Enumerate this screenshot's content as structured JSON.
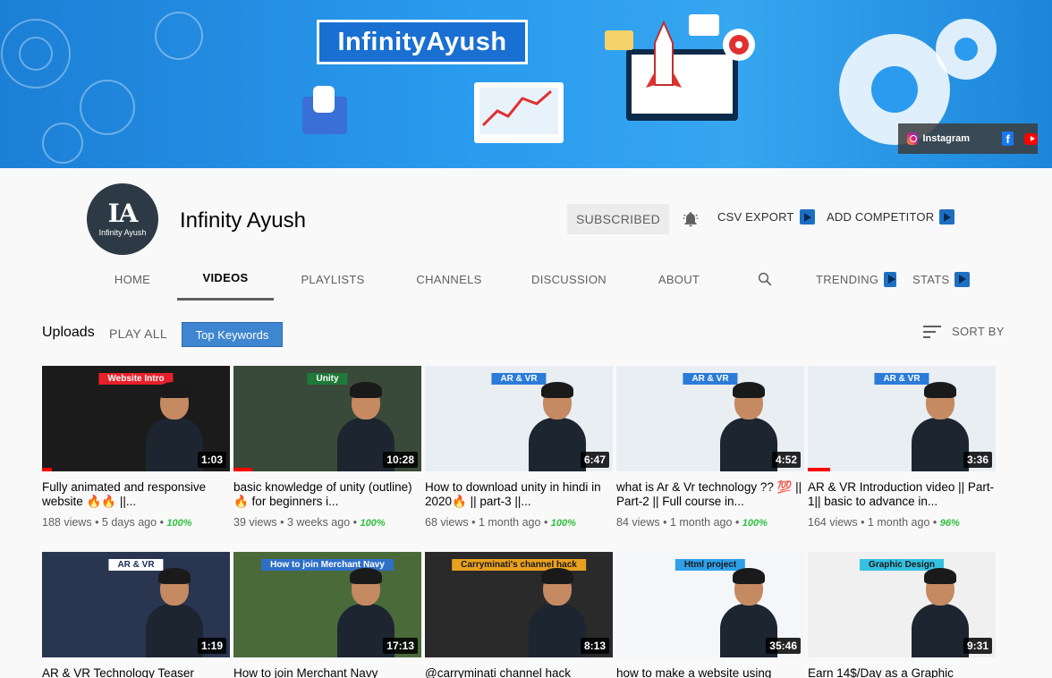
{
  "banner": {
    "title": "InfinityAyush",
    "social_label": "Instagram"
  },
  "channel": {
    "avatar_text": "IA",
    "avatar_sub": "Infinity Ayush",
    "name": "Infinity Ayush",
    "subscribed_label": "SUBSCRIBED",
    "csv_export_label": "CSV EXPORT",
    "add_competitor_label": "ADD COMPETITOR"
  },
  "tabs": {
    "home": "HOME",
    "videos": "VIDEOS",
    "playlists": "PLAYLISTS",
    "channels": "CHANNELS",
    "discussion": "DISCUSSION",
    "about": "ABOUT",
    "trending": "TRENDING",
    "stats": "STATS"
  },
  "uploads": {
    "title": "Uploads",
    "play_all": "PLAY ALL",
    "top_keywords": "Top Keywords",
    "sort_by": "SORT BY"
  },
  "videos": [
    {
      "duration": "1:03",
      "title": "Fully animated and responsive website 🔥🔥 ||...",
      "views": "188 views",
      "age": "5 days ago",
      "score": "100%",
      "progress": 0.05,
      "bg": "#1b1b1b",
      "label": "Website Intro",
      "label_bg": "#e8202a",
      "label_fg": "#ffffff"
    },
    {
      "duration": "10:28",
      "title": "basic knowledge of unity (outline) 🔥 for beginners i...",
      "views": "39 views",
      "age": "3 weeks ago",
      "score": "100%",
      "progress": 0.1,
      "bg": "#3a4a3a",
      "label": "Unity",
      "label_bg": "#1f7a3a",
      "label_fg": "#ffffff"
    },
    {
      "duration": "6:47",
      "title": "How to download unity in hindi in 2020🔥 || part-3 ||...",
      "views": "68 views",
      "age": "1 month ago",
      "score": "100%",
      "progress": 0.0,
      "bg": "#e9eef3",
      "label": "AR & VR",
      "label_bg": "#2b7bd8",
      "label_fg": "#ffffff"
    },
    {
      "duration": "4:52",
      "title": "what is Ar & Vr technology ?? 💯 || Part-2 || Full course in...",
      "views": "84 views",
      "age": "1 month ago",
      "score": "100%",
      "progress": 0.0,
      "bg": "#e9eef3",
      "label": "AR & VR",
      "label_bg": "#2b7bd8",
      "label_fg": "#ffffff"
    },
    {
      "duration": "3:36",
      "title": "AR & VR Introduction video || Part-1|| basic to advance in...",
      "views": "164 views",
      "age": "1 month ago",
      "score": "96%",
      "progress": 0.12,
      "bg": "#e9eef3",
      "label": "AR & VR",
      "label_bg": "#2b7bd8",
      "label_fg": "#ffffff"
    },
    {
      "duration": "1:19",
      "title": "AR & VR Technology Teaser",
      "views": "",
      "age": "",
      "score": "",
      "progress": 0.0,
      "bg": "#2a3550",
      "label": "AR & VR",
      "label_bg": "#ffffff",
      "label_fg": "#1a2a55"
    },
    {
      "duration": "17:13",
      "title": "How to join Merchant Navy",
      "views": "",
      "age": "",
      "score": "",
      "progress": 0.0,
      "bg": "#4a6a3a",
      "label": "How to join Merchant Navy",
      "label_bg": "#2f6fc8",
      "label_fg": "#ffffff"
    },
    {
      "duration": "8:13",
      "title": "@carryminati channel hack",
      "views": "",
      "age": "",
      "score": "",
      "progress": 0.0,
      "bg": "#2a2a2a",
      "label": "Carryminati's channel hack",
      "label_bg": "#e8a020",
      "label_fg": "#1a1a1a"
    },
    {
      "duration": "35:46",
      "title": "how to make a website using",
      "views": "",
      "age": "",
      "score": "",
      "progress": 0.0,
      "bg": "#f4f6fa",
      "label": "Html project",
      "label_bg": "#2fa0e8",
      "label_fg": "#1a1a1a"
    },
    {
      "duration": "9:31",
      "title": "Earn 14$/Day as a Graphic",
      "views": "",
      "age": "",
      "score": "",
      "progress": 0.0,
      "bg": "#f0f0f0",
      "label": "Graphic Design",
      "label_bg": "#35c0e0",
      "label_fg": "#1a1a1a"
    }
  ],
  "colors": {
    "accent_blue": "#3f86d0",
    "progress_red": "#ff0000",
    "score_green": "#2fbf40"
  }
}
